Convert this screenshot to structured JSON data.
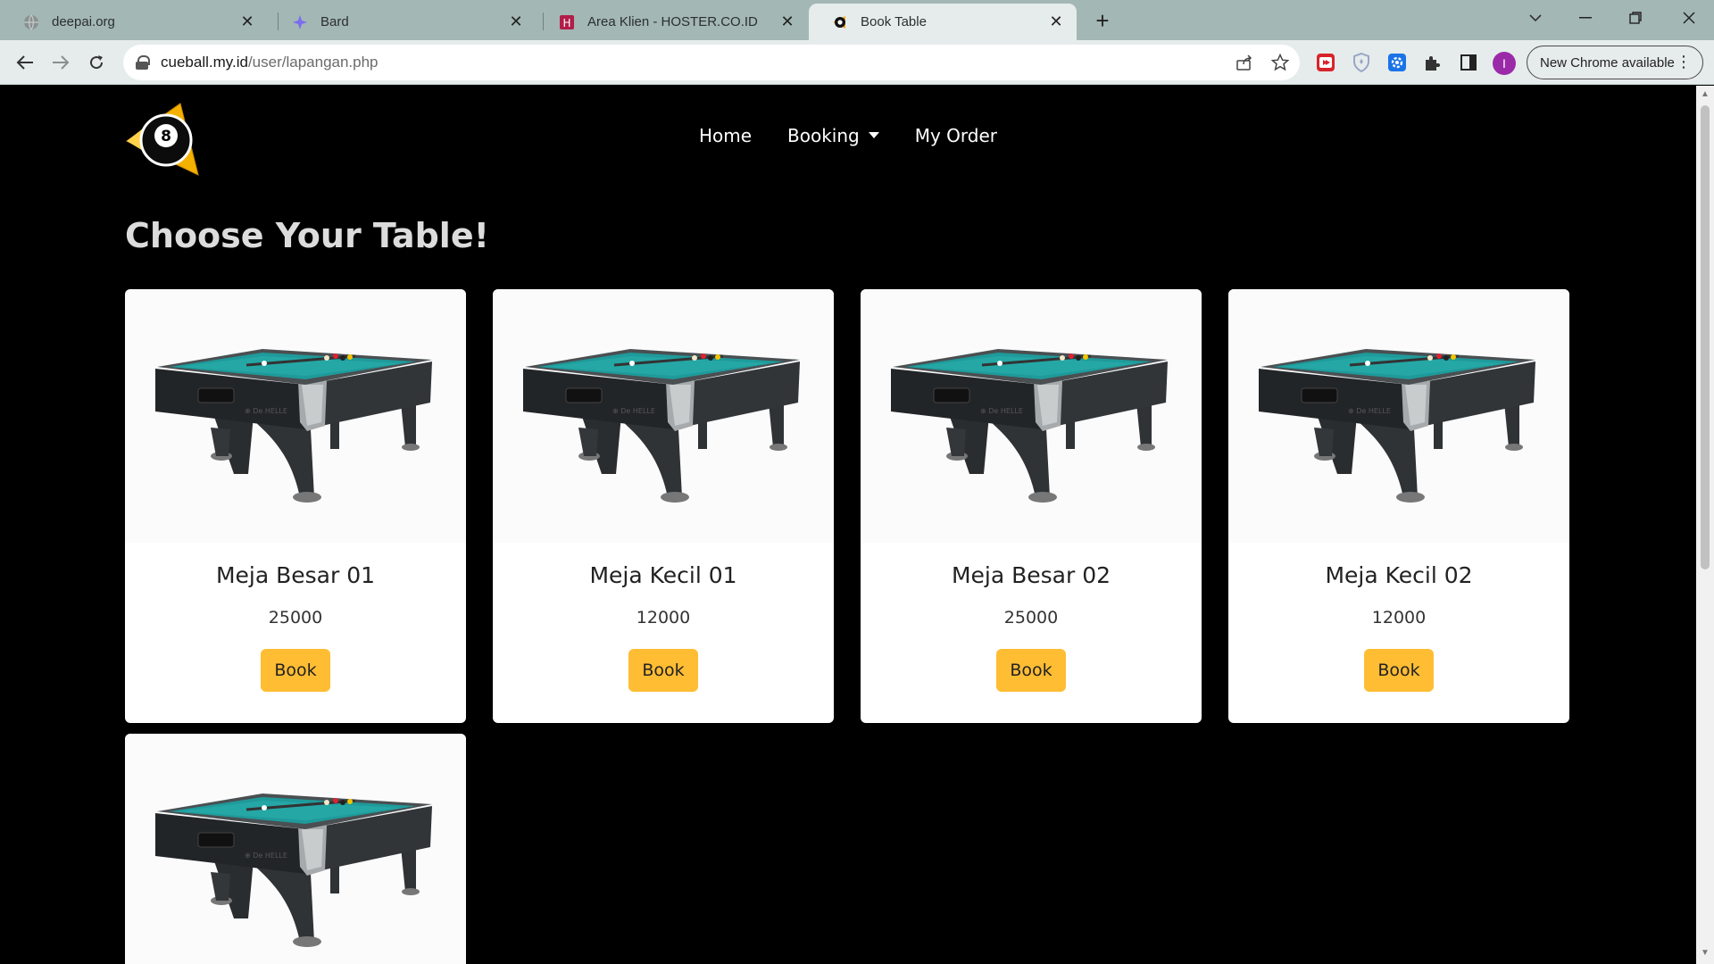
{
  "browser": {
    "tabs": [
      {
        "title": "deepai.org",
        "icon": "globe-icon",
        "active": false
      },
      {
        "title": "Bard",
        "icon": "bard-sparkle-icon",
        "active": false
      },
      {
        "title": "Area Klien - HOSTER.CO.ID",
        "icon": "hoster-icon",
        "active": false
      },
      {
        "title": "Book Table",
        "icon": "eight-ball-icon",
        "active": true
      }
    ],
    "url_host": "cueball.my.id",
    "url_path": "/user/lapangan.php",
    "profile_initial": "I",
    "update_label": "New Chrome available"
  },
  "site": {
    "nav": {
      "home": "Home",
      "booking": "Booking",
      "my_order": "My Order"
    },
    "heading": "Choose Your Table!"
  },
  "tables": [
    {
      "name": "Meja Besar 01",
      "price": "25000",
      "button": "Book"
    },
    {
      "name": "Meja Kecil 01",
      "price": "12000",
      "button": "Book"
    },
    {
      "name": "Meja Besar 02",
      "price": "25000",
      "button": "Book"
    },
    {
      "name": "Meja Kecil 02",
      "price": "12000",
      "button": "Book"
    },
    {
      "name": "",
      "price": "",
      "button": ""
    }
  ],
  "colors": {
    "accent": "#ffbd33",
    "page_bg": "#000000",
    "card_bg": "#ffffff",
    "felt": "#1f9a9a"
  }
}
